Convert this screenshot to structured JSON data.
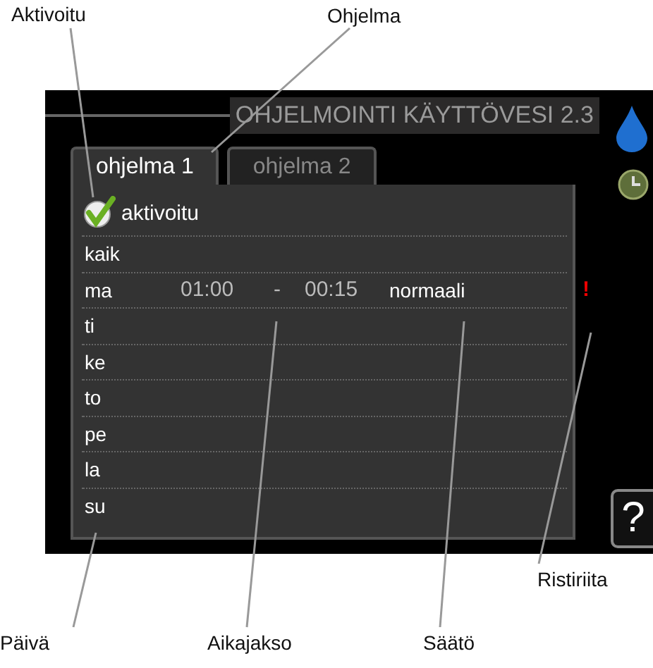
{
  "annotations": [
    {
      "label": "Aktivoitu"
    },
    {
      "label": "Ohjelma"
    },
    {
      "label": "Ristiriita"
    },
    {
      "label": "Päivä"
    },
    {
      "label": "Aikajakso"
    },
    {
      "label": "Säätö"
    }
  ],
  "screen": {
    "title": "OHJELMOINTI KÄYTTÖVESI 2.3",
    "tabs": [
      {
        "label": "ohjelma 1",
        "selected": true
      },
      {
        "label": "ohjelma 2",
        "selected": false
      }
    ],
    "activated": {
      "label": "aktivoitu",
      "checked": true
    },
    "rows": [
      {
        "day": "kaik"
      },
      {
        "day": "ma",
        "start": "01:00",
        "dash": "-",
        "end": "00:15",
        "setting": "normaali",
        "flag": "!"
      },
      {
        "day": "ti"
      },
      {
        "day": "ke"
      },
      {
        "day": "to"
      },
      {
        "day": "pe"
      },
      {
        "day": "la"
      },
      {
        "day": "su"
      }
    ],
    "help": "?"
  }
}
